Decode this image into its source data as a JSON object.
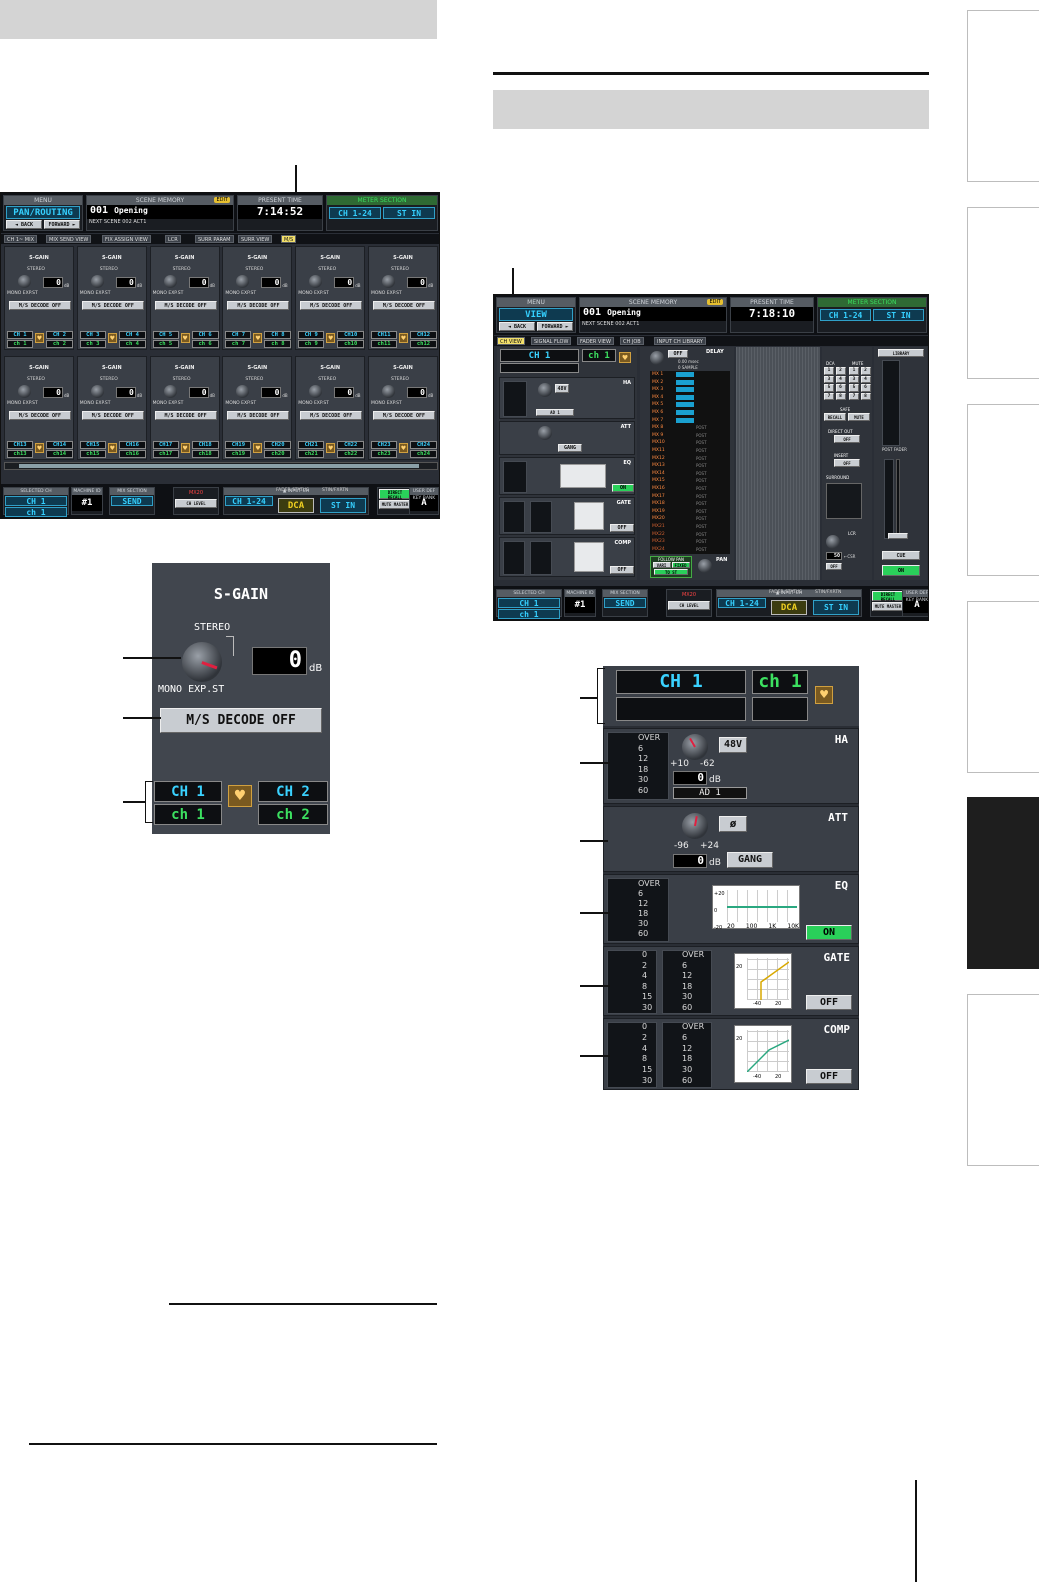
{
  "left_screen": {
    "menu_label": "MENU",
    "screen_name": "PAN/ROUTING",
    "back_label": "◄ BACK",
    "forward_label": "FORWARD ►",
    "scene_memory_label": "SCENE MEMORY",
    "edit_badge": "EDIT",
    "scene_number": "001",
    "scene_name": "Opening",
    "next_scene_label": "NEXT SCENE",
    "next_scene": "002 ACT1",
    "present_time_label": "PRESENT TIME",
    "present_time": "7:14:52",
    "meter_section_label": "METER SECTION",
    "meter_ch": "CH 1-24",
    "meter_st": "ST IN",
    "tabs": [
      "CH 1~ MIX",
      "MIX SEND VIEW",
      "FIX ASSIGN VIEW",
      "LCR",
      "SURR PARAM",
      "SURR VIEW",
      "M/S"
    ],
    "cell_title": "S-GAIN",
    "cell_stereo": "STEREO",
    "cell_mono": "MONO EXP.ST",
    "cell_value": "0",
    "cell_unit": "dB",
    "cell_decode": "M/S DECODE OFF",
    "row1_pairs": [
      [
        "CH 1",
        "CH 2",
        "ch 1",
        "ch 2"
      ],
      [
        "CH 3",
        "CH 4",
        "ch 3",
        "ch 4"
      ],
      [
        "CH 5",
        "CH 6",
        "ch 5",
        "ch 6"
      ],
      [
        "CH 7",
        "CH 8",
        "ch 7",
        "ch 8"
      ],
      [
        "CH 9",
        "CH10",
        "ch 9",
        "ch10"
      ],
      [
        "CH11",
        "CH12",
        "ch11",
        "ch12"
      ]
    ],
    "row2_pairs": [
      [
        "CH13",
        "CH14",
        "ch13",
        "ch14"
      ],
      [
        "CH15",
        "CH16",
        "ch15",
        "ch16"
      ],
      [
        "CH17",
        "CH18",
        "ch17",
        "ch18"
      ],
      [
        "CH19",
        "CH20",
        "ch19",
        "ch20"
      ],
      [
        "CH21",
        "CH22",
        "ch21",
        "ch22"
      ],
      [
        "CH23",
        "CH24",
        "ch23",
        "ch24"
      ]
    ],
    "footer": {
      "selected_ch_label": "SELECTED CH",
      "selected_ch": "CH 1",
      "selected_ch_name": "ch 1",
      "machine_id_label": "MACHINE ID",
      "machine_id": "#1",
      "mix_section_label": "MIX SECTION",
      "mix_section": "SEND",
      "mix_name": "MX20",
      "ch_level": "CH LEVEL",
      "input_ch_label": "▲ INPUT CH",
      "fader_status_label": "FADER STATUS",
      "input_ch": "CH 1-24",
      "dca": "DCA",
      "stin_label": "STIN/FXRTN",
      "stin": "ST IN",
      "direct_recall": "DIRECT RECALL",
      "mute_master": "MUTE MASTER",
      "user_def_label": "USER DEF KEY BANK",
      "user_def": "A"
    }
  },
  "left_zoom": {
    "title": "S-GAIN",
    "stereo": "STEREO",
    "mono": "MONO EXP.ST",
    "value": "0",
    "unit": "dB",
    "decode_button": "M/S DECODE OFF",
    "ch_a": "CH 1",
    "ch_b": "CH 2",
    "name_a": "ch 1",
    "name_b": "ch 2"
  },
  "right_screen": {
    "menu_label": "MENU",
    "screen_name": "VIEW",
    "back_label": "◄ BACK",
    "forward_label": "FORWARD ►",
    "scene_memory_label": "SCENE MEMORY",
    "edit_badge": "EDIT",
    "scene_number": "001",
    "scene_name": "Opening",
    "next_scene_label": "NEXT SCENE",
    "next_scene": "002 ACT1",
    "present_time_label": "PRESENT TIME",
    "present_time": "7:18:10",
    "meter_section_label": "METER SECTION",
    "meter_ch": "CH 1-24",
    "meter_st": "ST IN",
    "tabs": [
      "CH VIEW",
      "SIGNAL FLOW",
      "FADER VIEW",
      "CH JOB",
      "INPUT CH LIBRARY"
    ],
    "ch_main": "CH 1",
    "ch_name": "ch 1",
    "delay_label": "DELAY",
    "delay_off": "OFF",
    "delay_ms": "0.00 msec",
    "delay_sample": "0 SAMPLE",
    "mix_rows": [
      "MX 1",
      "MX 2",
      "MX 3",
      "MX 4",
      "MX 5",
      "MX 6",
      "MX 7",
      "MX 8",
      "MX 9",
      "MX10",
      "MX11",
      "MX12",
      "MX13",
      "MX14",
      "MX15",
      "MX16",
      "MX17",
      "MX18",
      "MX19",
      "MX20",
      "MX21",
      "MX22",
      "MX23",
      "MX24"
    ],
    "post_label": "POST",
    "dca_label": "DCA",
    "mute_label": "MUTE",
    "dca_numbers": [
      "1",
      "2",
      "3",
      "4",
      "5",
      "6",
      "7",
      "8"
    ],
    "safe_label": "SAFE",
    "recall_btn": "RECALL",
    "mute_btn": "MUTE",
    "direct_out_label": "DIRECT OUT",
    "direct_out_btn": "OFF",
    "insert_label": "INSERT",
    "insert_btn": "OFF",
    "surround_label": "SURROUND",
    "lcr_label": "LCR",
    "lcr_value": "50",
    "lcr_unit": "←CSR",
    "lcr_off": "OFF",
    "library_label": "LIBRARY",
    "post_fader": "POST FADER",
    "cue_label": "CUE",
    "on_label": "ON",
    "follow_pan": "FOLLOW PAN",
    "vari_label": "VARI",
    "fixed_label": "FIXED",
    "to_st": "TO ST",
    "pan_label": "PAN",
    "ha_label": "HA",
    "att_label": "ATT",
    "eq_label": "EQ",
    "gate_label": "GATE",
    "comp_label": "COMP",
    "phantom": "48V",
    "ad_label": "AD 1",
    "gang": "GANG",
    "eq_on": "ON",
    "gate_off": "OFF",
    "comp_off": "OFF",
    "footer": {
      "selected_ch_label": "SELECTED CH",
      "selected_ch": "CH 1",
      "selected_ch_name": "ch 1",
      "machine_id_label": "MACHINE ID",
      "machine_id": "#1",
      "mix_section_label": "MIX SECTION",
      "mix_section": "SEND",
      "mix_name": "MX20",
      "ch_level": "CH LEVEL",
      "input_ch_label": "▲ INPUT CH",
      "fader_status_label": "FADER STATUS",
      "input_ch": "CH 1-24",
      "dca": "DCA",
      "stin_label": "STIN/FXRTN",
      "stin": "ST IN",
      "direct_recall": "DIRECT RECALL",
      "mute_master": "MUTE MASTER",
      "user_def_label": "USER DEF KEY BANK",
      "user_def": "A"
    }
  },
  "right_zoom": {
    "ch_main": "CH 1",
    "ch_name": "ch 1",
    "ha_label": "HA",
    "ha_meter": [
      "OVER",
      "6",
      "12",
      "18",
      "30",
      "60"
    ],
    "phantom": "48V",
    "ha_min": "+10",
    "ha_max": "-62",
    "ha_value": "0",
    "ha_unit": "dB",
    "ad_label": "AD 1",
    "att_label": "ATT",
    "att_phase": "ø",
    "att_min": "-96",
    "att_max": "+24",
    "att_value": "0",
    "att_unit": "dB",
    "gang": "GANG",
    "eq_label": "EQ",
    "eq_meter": [
      "OVER",
      "6",
      "12",
      "18",
      "30",
      "60"
    ],
    "eq_y": [
      "+20",
      "0",
      "-20"
    ],
    "eq_x": [
      "20",
      "100",
      "1K",
      "10K"
    ],
    "eq_on": "ON",
    "gate_label": "GATE",
    "gate_meter_a": [
      "0",
      "2",
      "4",
      "8",
      "15",
      "30"
    ],
    "gate_meter_b": [
      "OVER",
      "6",
      "12",
      "18",
      "30",
      "60"
    ],
    "gate_graph_y": "20",
    "gate_graph_x": [
      "-40",
      "20"
    ],
    "gate_off": "OFF",
    "comp_label": "COMP",
    "comp_meter_a": [
      "0",
      "2",
      "4",
      "8",
      "15",
      "30"
    ],
    "comp_meter_b": [
      "OVER",
      "6",
      "12",
      "18",
      "30",
      "60"
    ],
    "comp_graph_y": "20",
    "comp_graph_x": [
      "-40",
      "20"
    ],
    "comp_off": "OFF"
  }
}
